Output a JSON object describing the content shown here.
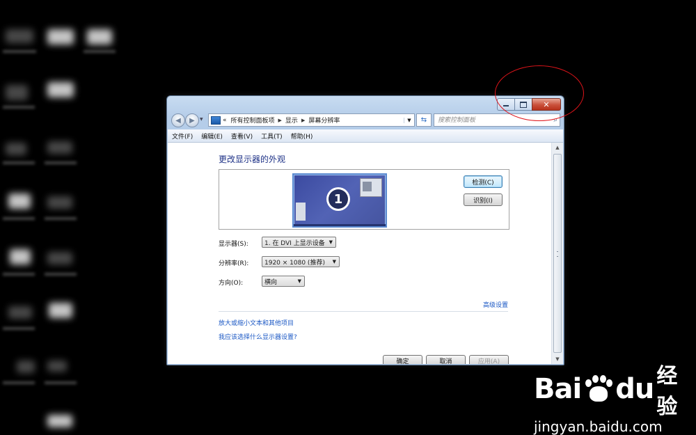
{
  "window": {
    "address": {
      "overflow": "«",
      "crumbs": [
        "所有控制面板项",
        "显示",
        "屏幕分辨率"
      ]
    },
    "search_placeholder": "搜索控制面板",
    "menu": [
      "文件(F)",
      "编辑(E)",
      "查看(V)",
      "工具(T)",
      "帮助(H)"
    ],
    "caption": {
      "close": "✕"
    }
  },
  "display": {
    "title": "更改显示器的外观",
    "monitor_number": "1",
    "detect_button": "检测(C)",
    "identify_button": "识别(I)",
    "fields": {
      "display_label": "显示器(S):",
      "display_value": "1. 在 DVI 上显示设备",
      "resolution_label": "分辨率(R):",
      "resolution_value": "1920 × 1080 (推荐)",
      "orientation_label": "方向(O):",
      "orientation_value": "横向"
    },
    "advanced_link": "高级设置",
    "links": [
      "放大或缩小文本和其他项目",
      "我应该选择什么显示器设置?"
    ],
    "buttons": [
      "确定",
      "取消",
      "应用(A)"
    ]
  },
  "watermark": {
    "brand": "Bai",
    "brand_suffix": "du",
    "product": "经验",
    "url": "jingyan.baidu.com"
  },
  "colors": {
    "annotation": "#e0141a",
    "link": "#1a57c4",
    "title": "#1e3287"
  }
}
